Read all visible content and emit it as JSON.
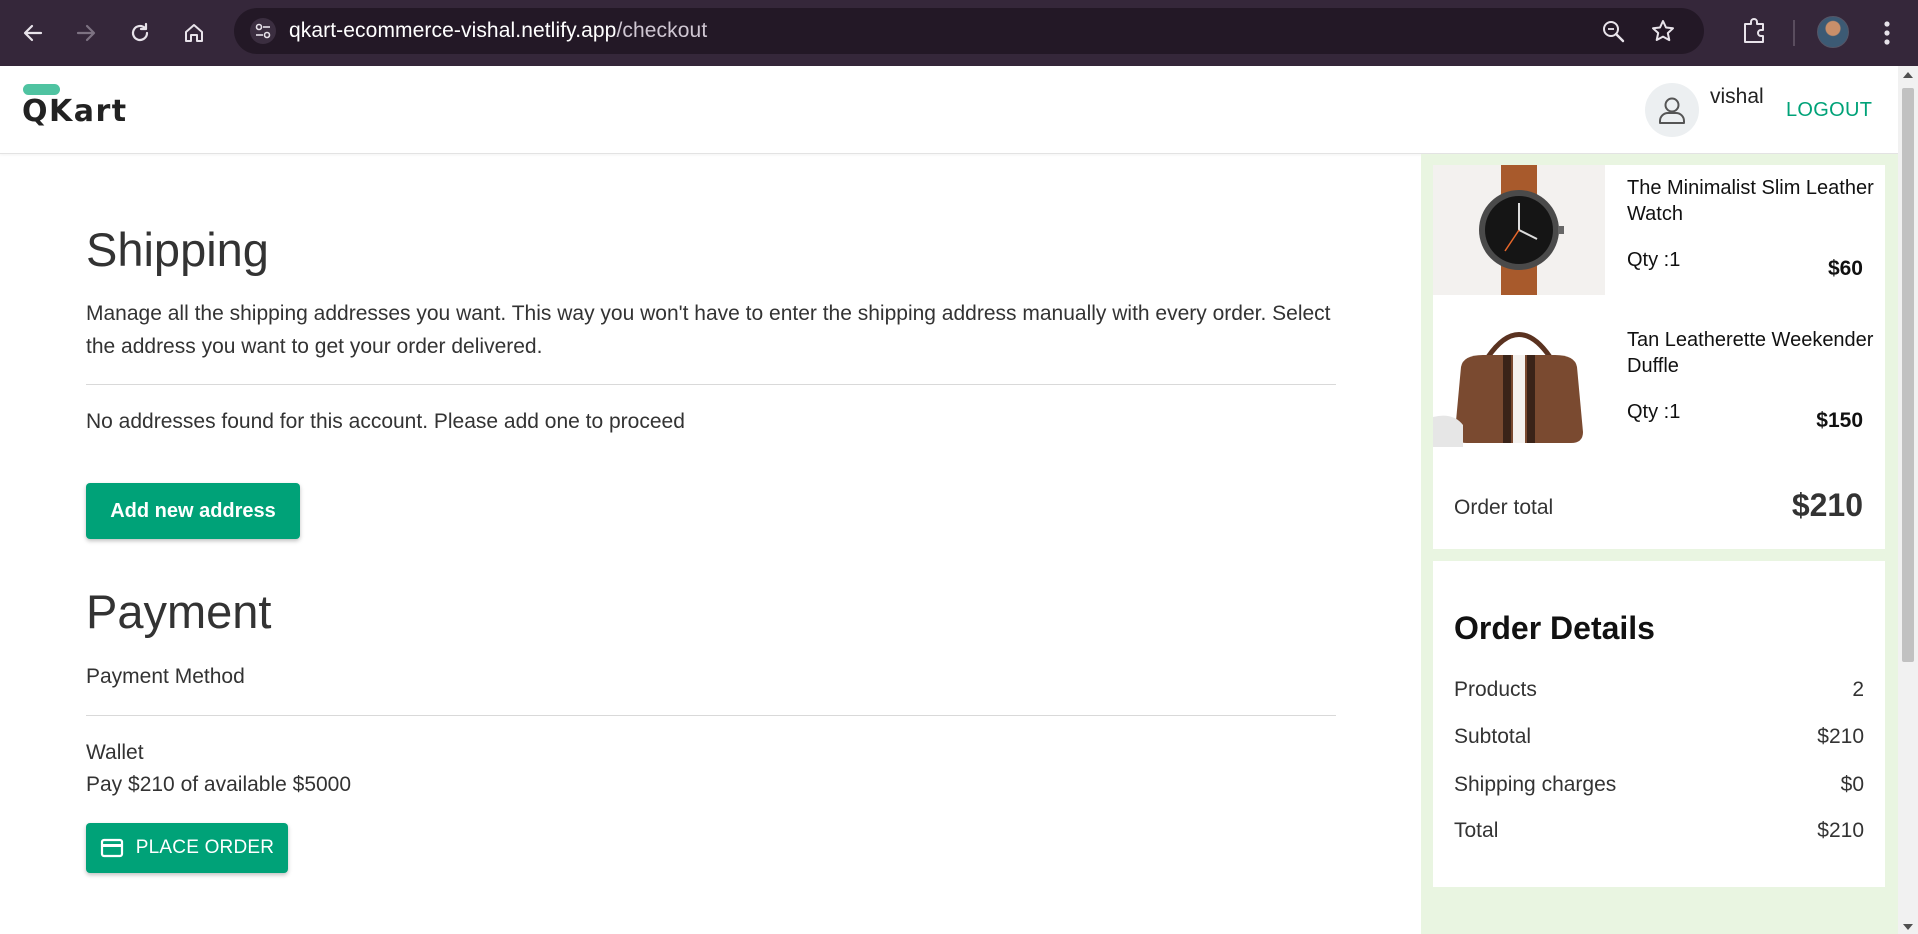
{
  "browser": {
    "url_host": "qkart-ecommerce-vishal.netlify.app",
    "url_path": "/checkout",
    "icons": [
      "back-arrow-icon",
      "forward-arrow-icon",
      "reload-icon",
      "home-icon",
      "site-info-icon",
      "zoom-icon",
      "bookmark-star-icon",
      "extensions-icon",
      "profile-avatar",
      "menu-icon"
    ]
  },
  "header": {
    "logo_text": "QKart",
    "username": "vishal",
    "logout_label": "LOGOUT"
  },
  "shipping": {
    "title": "Shipping",
    "description": "Manage all the shipping addresses you want. This way you won't have to enter the shipping address manually with every order. Select the address you want to get your order delivered.",
    "no_address_text": "No addresses found for this account. Please add one to proceed",
    "add_button_label": "Add new address"
  },
  "payment": {
    "title": "Payment",
    "method_label": "Payment Method",
    "wallet_label": "Wallet",
    "wallet_text": "Pay $210 of available $5000",
    "place_order_label": "PLACE ORDER"
  },
  "cart": {
    "items": [
      {
        "name": "The Minimalist Slim Leather Watch",
        "qty": "Qty :1",
        "price": "$60"
      },
      {
        "name": "Tan Leatherette Weekender Duffle",
        "qty": "Qty :1",
        "price": "$150"
      }
    ],
    "order_total_label": "Order total",
    "order_total_value": "$210"
  },
  "order_details": {
    "title": "Order Details",
    "rows": [
      {
        "label": "Products",
        "value": "2"
      },
      {
        "label": "Subtotal",
        "value": "$210"
      },
      {
        "label": "Shipping charges",
        "value": "$0"
      },
      {
        "label": "Total",
        "value": "$210"
      }
    ]
  },
  "colors": {
    "brand_green": "#00a278",
    "logo_accent": "#4fc3a1",
    "side_panel_bg": "#e9f5e1",
    "chrome_bg": "#35273a"
  }
}
